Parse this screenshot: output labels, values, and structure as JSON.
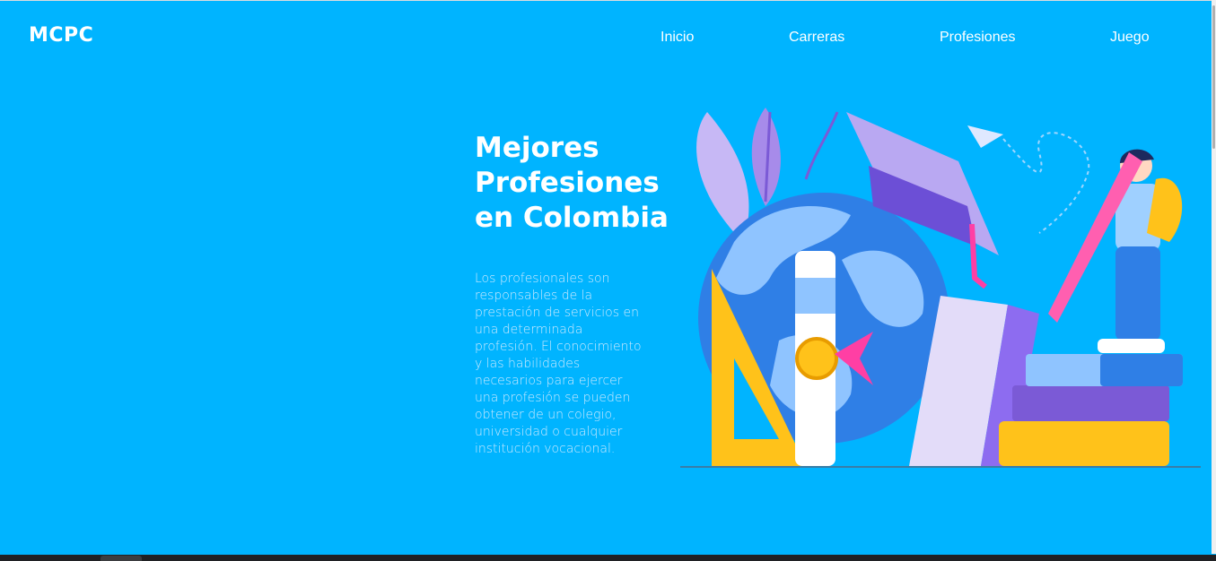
{
  "header": {
    "logo": "MCPC",
    "nav": [
      {
        "label": "Inicio"
      },
      {
        "label": "Carreras"
      },
      {
        "label": "Profesiones"
      },
      {
        "label": "Juego"
      }
    ]
  },
  "hero": {
    "title": "Mejores Profesiones en Colombia",
    "description": "Los profesionales son responsables de la prestación de servicios en una determinada profesión. El conocimiento y las habilidades necesarios para ejercer una profesión se pueden obtener de un colegio, universidad o cualquier institución vocacional."
  },
  "colors": {
    "background": "#00b4ff",
    "text": "#ffffff",
    "description_text": "#cdeaff"
  }
}
